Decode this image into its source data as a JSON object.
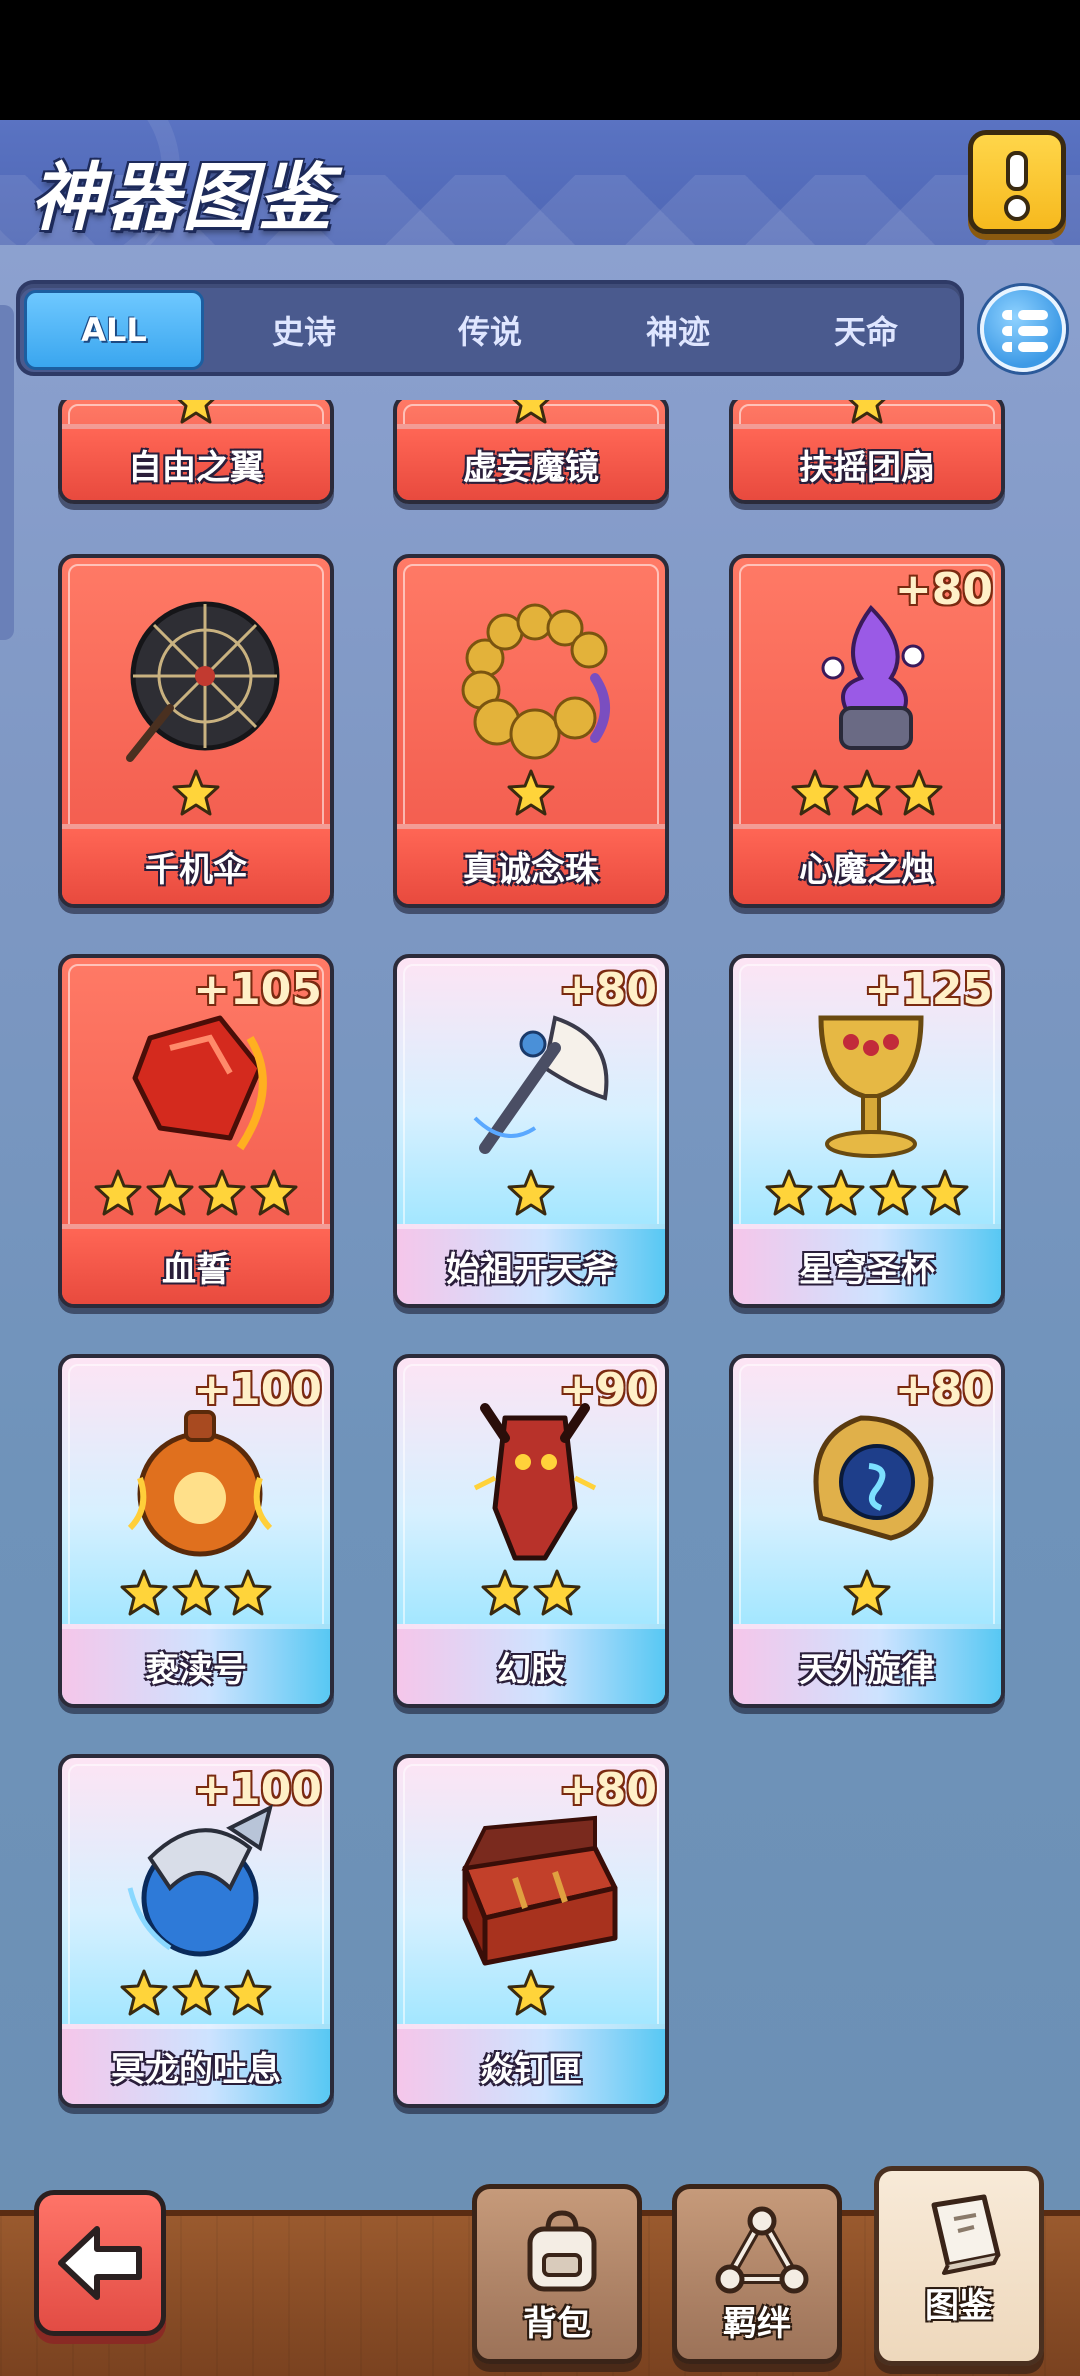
{
  "header": {
    "title": "神器图鉴",
    "info_icon": "exclamation-icon"
  },
  "tabs": [
    {
      "label": "ALL",
      "active": true
    },
    {
      "label": "史诗",
      "active": false
    },
    {
      "label": "传说",
      "active": false
    },
    {
      "label": "神迹",
      "active": false
    },
    {
      "label": "天命",
      "active": false
    }
  ],
  "menu_icon": "list-menu-icon",
  "artifacts_partial": [
    {
      "name": "自由之翼",
      "stars": 1,
      "rarity": "red"
    },
    {
      "name": "虚妄魔镜",
      "stars": 1,
      "rarity": "red"
    },
    {
      "name": "扶摇团扇",
      "stars": 1,
      "rarity": "red"
    }
  ],
  "artifacts": [
    {
      "name": "千机伞",
      "stars": 1,
      "bonus": "",
      "rarity": "red",
      "icon": "umbrella-icon"
    },
    {
      "name": "真诚念珠",
      "stars": 1,
      "bonus": "",
      "rarity": "red",
      "icon": "prayer-beads-icon"
    },
    {
      "name": "心魔之烛",
      "stars": 3,
      "bonus": "+80",
      "rarity": "red",
      "icon": "candle-icon"
    },
    {
      "name": "血誓",
      "stars": 4,
      "bonus": "+105",
      "rarity": "red",
      "icon": "blood-gem-icon"
    },
    {
      "name": "始祖开天斧",
      "stars": 1,
      "bonus": "+80",
      "rarity": "rainbow",
      "icon": "axe-icon"
    },
    {
      "name": "星穹圣杯",
      "stars": 4,
      "bonus": "+125",
      "rarity": "rainbow",
      "icon": "chalice-icon"
    },
    {
      "name": "亵渎号",
      "stars": 3,
      "bonus": "+100",
      "rarity": "rainbow",
      "icon": "bottle-icon"
    },
    {
      "name": "幻肢",
      "stars": 2,
      "bonus": "+90",
      "rarity": "rainbow",
      "icon": "demon-arm-icon"
    },
    {
      "name": "天外旋律",
      "stars": 1,
      "bonus": "+80",
      "rarity": "rainbow",
      "icon": "lyre-icon"
    },
    {
      "name": "冥龙的吐息",
      "stars": 3,
      "bonus": "+100",
      "rarity": "rainbow",
      "icon": "dragon-icon"
    },
    {
      "name": "焱钉匣",
      "stars": 1,
      "bonus": "+80",
      "rarity": "rainbow",
      "icon": "chest-icon"
    }
  ],
  "bottom_nav": {
    "back_icon": "back-arrow-icon",
    "items": [
      {
        "label": "背包",
        "icon": "backpack-icon",
        "active": false
      },
      {
        "label": "羁绊",
        "icon": "bond-icon",
        "active": false
      },
      {
        "label": "图鉴",
        "icon": "book-icon",
        "active": true
      }
    ]
  },
  "colors": {
    "red_card": "#f0574a",
    "rainbow_card": "#7ee0ff",
    "accent_tab": "#3aa6ef",
    "star": "#ffd43a"
  }
}
